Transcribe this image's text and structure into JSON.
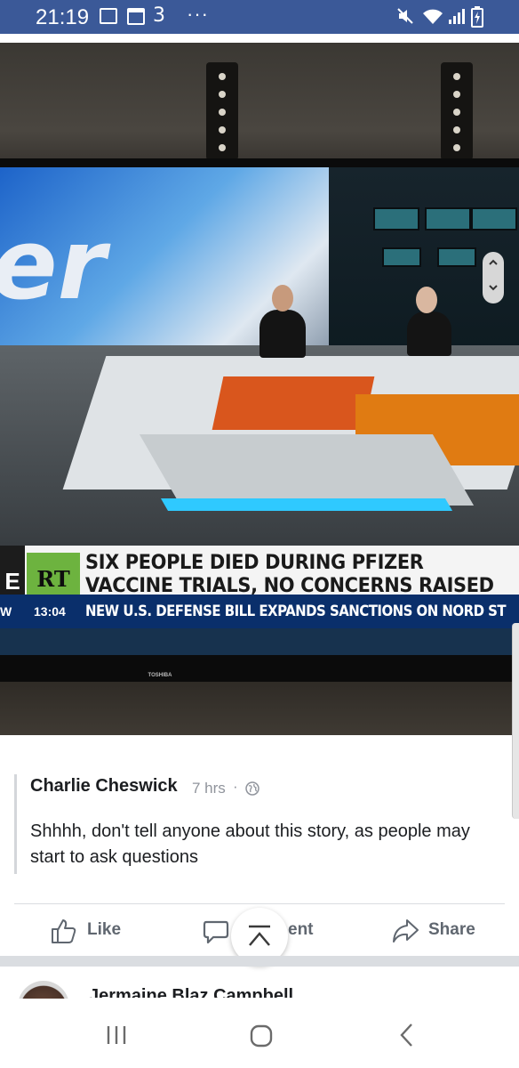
{
  "status_bar": {
    "time": "21:19",
    "carrier_glyph": "3",
    "more": "···",
    "icons": [
      "gallery-icon",
      "calendar-icon",
      "three-network-icon",
      "mute-icon",
      "wifi-icon",
      "signal-icon",
      "battery-charging-icon"
    ]
  },
  "photo": {
    "screen_letters": "er",
    "chyron": {
      "edge_letter": "E",
      "logo": "RT",
      "headline_line1": "SIX PEOPLE DIED DURING PFIZER",
      "headline_line2": "VACCINE TRIALS, NO CONCERNS RAISED",
      "ticker_left": "W",
      "ticker_time": "13:04",
      "ticker_text": "NEW U.S. DEFENSE BILL EXPANDS SANCTIONS ON NORD ST"
    },
    "tv_brand": "TOSHIBA"
  },
  "post": {
    "author": "Charlie Cheswick",
    "time": "7 hrs",
    "separator": "·",
    "privacy_icon": "globe-icon",
    "text": "Shhhh, don't tell anyone about this story, as people may start to ask questions"
  },
  "actions": {
    "like": "Like",
    "comment": "ent",
    "share": "Share"
  },
  "next_post": {
    "author": "Jermaine Blaz Campbell"
  },
  "colors": {
    "status_bar": "#3b5998",
    "rt_green": "#6db33f",
    "ticker_blue": "#0a2f6b",
    "action_gray": "#606770"
  }
}
